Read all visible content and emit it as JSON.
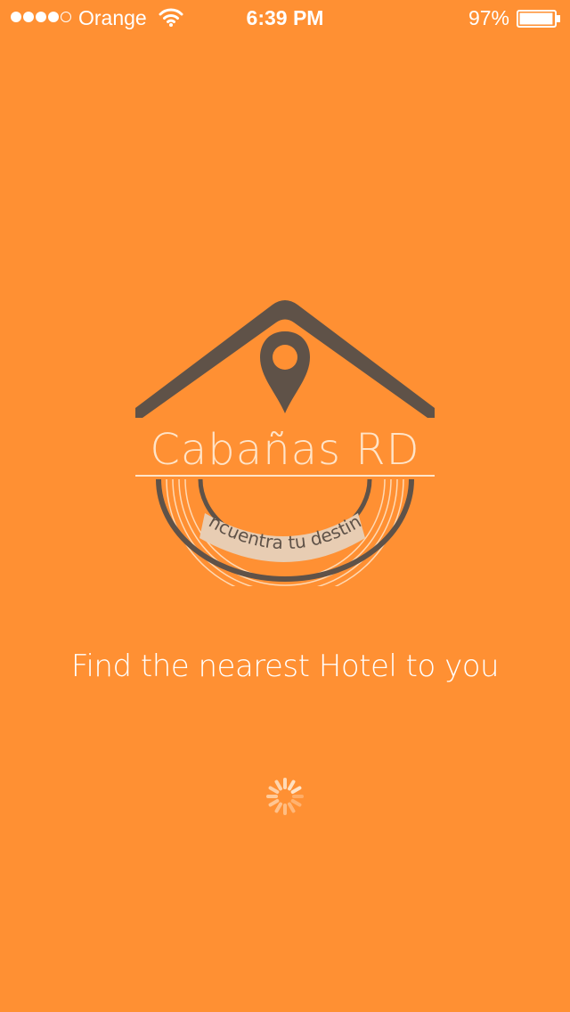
{
  "status_bar": {
    "signal_dots_filled": 4,
    "signal_dots_total": 5,
    "carrier": "Orange",
    "time": "6:39 PM",
    "battery_percent": "97%",
    "battery_level": 0.97
  },
  "logo": {
    "brand_name": "Cabañas RD",
    "slogan": "encuentra tu destino"
  },
  "tagline": "Find the nearest Hotel to you",
  "loading": true,
  "colors": {
    "background": "#FF9033",
    "logo_brown": "#5F5248",
    "logo_cream": "#FFE4C8",
    "ribbon": "#E8CDB3"
  },
  "icons": [
    "wifi-icon",
    "battery-icon",
    "location-pin-icon",
    "loading-spinner-icon"
  ]
}
